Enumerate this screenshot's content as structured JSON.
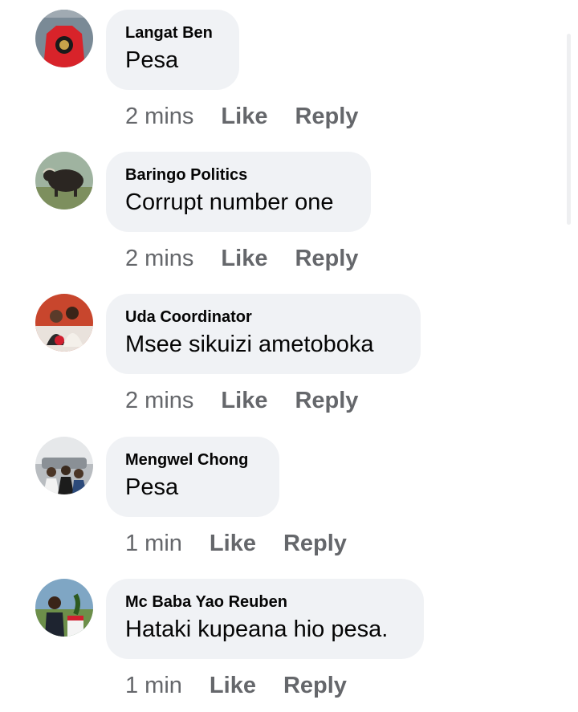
{
  "comments": [
    {
      "author": "Langat Ben",
      "text": "Pesa",
      "time": "2 mins",
      "like": "Like",
      "reply": "Reply",
      "avatar": "red-jersey-avatar"
    },
    {
      "author": "Baringo Politics",
      "text": "Corrupt number one",
      "time": "2 mins",
      "like": "Like",
      "reply": "Reply",
      "avatar": "buffalo-avatar"
    },
    {
      "author": "Uda Coordinator",
      "text": "Msee sikuizi ametoboka",
      "time": "2 mins",
      "like": "Like",
      "reply": "Reply",
      "avatar": "couple-avatar"
    },
    {
      "author": "Mengwel Chong",
      "text": "Pesa",
      "time": "1 min",
      "like": "Like",
      "reply": "Reply",
      "avatar": "group-avatar"
    },
    {
      "author": "Mc Baba Yao Reuben",
      "text": "Hataki kupeana hio pesa.",
      "time": "1 min",
      "like": "Like",
      "reply": "Reply",
      "avatar": "podium-avatar"
    }
  ],
  "colors": {
    "bubble": "#f0f2f5",
    "text": "#050505",
    "meta": "#65676b"
  }
}
